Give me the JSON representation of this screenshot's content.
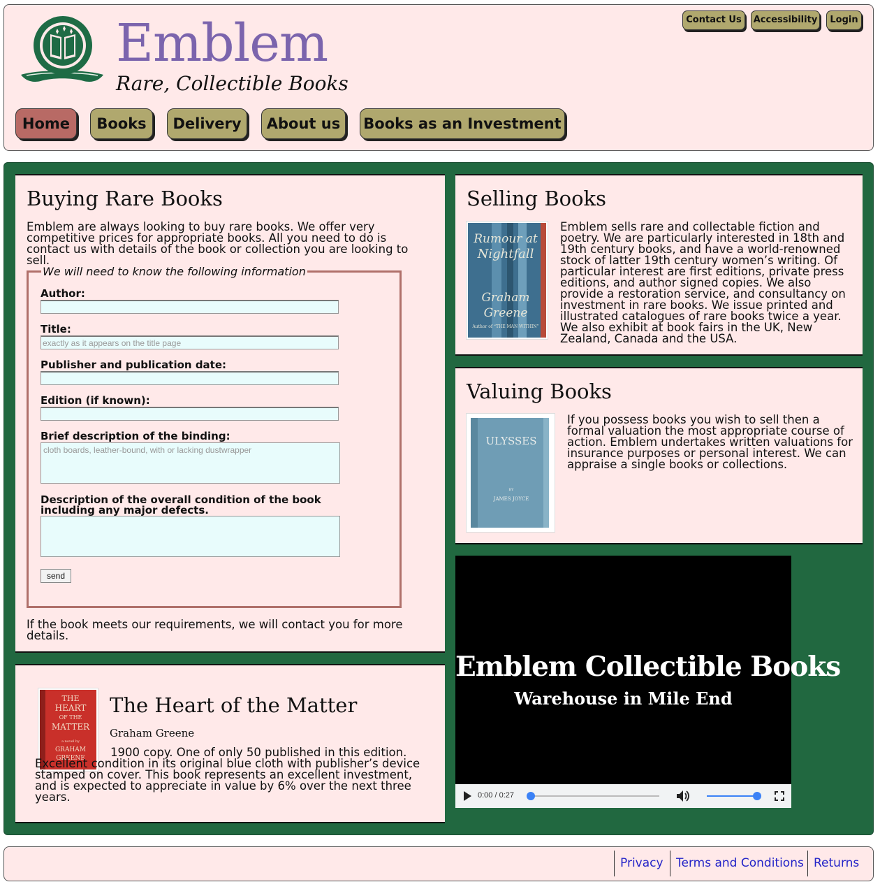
{
  "brand": {
    "name": "Emblem",
    "tagline": "Rare, Collectible Books",
    "colors": {
      "name": "#7b64ad",
      "logo": "#1e6b45",
      "header_bg": "#ffe9e9",
      "main_bg": "#216840"
    }
  },
  "utility_nav": [
    "Contact Us",
    "Accessibility",
    "Login"
  ],
  "nav": {
    "items": [
      "Home",
      "Books",
      "Delivery",
      "About us",
      "Books as an Investment"
    ],
    "active": "Home"
  },
  "buying": {
    "title": "Buying Rare Books",
    "intro": "Emblem are always looking to buy rare books. We offer very competitive prices for appropriate books. All you need to do is contact us with details of the book or collection you are looking to sell.",
    "form": {
      "legend": "We will need to know the following information",
      "author_label": "Author:",
      "title_label": "Title:",
      "title_placeholder": "exactly as it appears on the title page",
      "publisher_label": "Publisher and publication date:",
      "edition_label": "Edition (if known):",
      "binding_label": "Brief description of the binding:",
      "binding_placeholder": "cloth boards, leather-bound, with or lacking dustwrapper",
      "condition_label": "Description of the overall condition of the book including any major defects.",
      "send_label": "send"
    },
    "outro": "If the book meets our requirements, we will contact you for more details."
  },
  "featured": {
    "title": "The Heart of the Matter",
    "author": "Graham Greene",
    "description": "1900 copy. One of only 50 published in this edition. Excellent condition in its original blue cloth with publisher’s device stamped on cover. This book represents an excellent investment, and is expected to appreciate in value by 6% over the next three years.",
    "cover": {
      "title_lines": [
        "THE",
        "HEART",
        "OF THE",
        "MATTER"
      ],
      "small": "a novel by",
      "author_lines": [
        "GRAHAM",
        "GREENE"
      ]
    }
  },
  "selling": {
    "title": "Selling Books",
    "text": "Emblem sells rare and collectable fiction and poetry. We are particularly interested in 18th and 19th century books, and have a world-renowned stock of latter 19th century women’s writing. Of particular interest are first editions, private press editions, and author signed copies. We also provide a restoration service, and consultancy on investment in rare books. We issue printed and illustrated catalogues of rare books twice a year. We also exhibit at book fairs in the UK, New Zealand, Canada and the USA.",
    "cover": {
      "title_lines": [
        "Rumour at",
        "Nightfall"
      ],
      "author_lines": [
        "Graham",
        "Greene"
      ],
      "small": "Author of “THE MAN WITHIN”"
    }
  },
  "valuing": {
    "title": "Valuing Books",
    "text": "If you possess books you wish to sell then a formal valuation the most appropriate course of action. Emblem undertakes written valuations for insurance purposes or personal interest. We can appraise a single books or collections.",
    "cover": {
      "title": "ULYSSES",
      "by": "BY",
      "author": "JAMES JOYCE"
    }
  },
  "video": {
    "title": "Emblem Collectible Books",
    "subtitle": "Warehouse in Mile End",
    "time": "0:00 / 0:27",
    "progress": 0,
    "volume": 1.0
  },
  "footer": {
    "links": [
      "Privacy",
      "Terms and Conditions",
      "Returns"
    ]
  }
}
